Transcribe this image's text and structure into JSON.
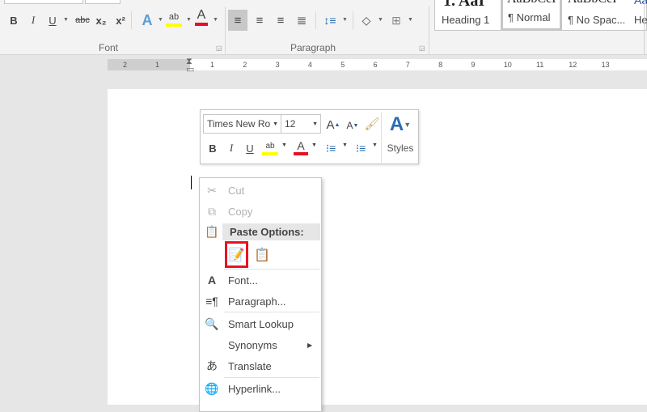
{
  "ribbon": {
    "font_group": {
      "label": "Font",
      "bold": "B",
      "italic": "I",
      "underline": "U",
      "strikethrough": "abc",
      "subscript": "x₂",
      "superscript": "x²",
      "text_effects": "A",
      "highlight": "ab",
      "font_color": "A"
    },
    "paragraph_group": {
      "label": "Paragraph"
    },
    "styles": [
      {
        "preview": "1. AaI",
        "name": "Heading 1"
      },
      {
        "preview": "AaBbCcI",
        "name": "¶ Normal",
        "selected": true
      },
      {
        "preview": "AaBbCcI",
        "name": "¶ No Spac..."
      },
      {
        "preview": "Aa",
        "name": "He"
      }
    ],
    "colors": {
      "highlight": "#ffff00",
      "font_color": "#e81123",
      "accent": "#2b579a"
    }
  },
  "ruler": {
    "left_ticks": [
      "2",
      "1"
    ],
    "right_ticks": [
      "1",
      "2",
      "3",
      "4",
      "5",
      "6",
      "7",
      "8",
      "9",
      "10",
      "11",
      "12",
      "13"
    ]
  },
  "mini_toolbar": {
    "font_name": "Times New Ro",
    "font_size": "12",
    "grow": "A",
    "shrink": "A",
    "bold": "B",
    "italic": "I",
    "underline": "U",
    "highlight": "ab",
    "font_color": "A",
    "styles_label": "Styles"
  },
  "context_menu": {
    "items": [
      {
        "label": "Cut",
        "icon": "scissors-icon",
        "disabled": true
      },
      {
        "label": "Copy",
        "icon": "copy-icon",
        "disabled": true
      },
      {
        "label": "Paste Options:",
        "icon": "paste-icon",
        "header": true
      },
      {
        "label": "Font...",
        "icon": "font-icon"
      },
      {
        "label": "Paragraph...",
        "icon": "paragraph-icon"
      },
      {
        "label": "Smart Lookup",
        "icon": "smart-lookup-icon"
      },
      {
        "label": "Synonyms",
        "icon": "",
        "submenu": true
      },
      {
        "label": "Translate",
        "icon": "translate-icon"
      },
      {
        "label": "Hyperlink...",
        "icon": "hyperlink-icon"
      }
    ],
    "paste_options": [
      "keep-source-formatting",
      "merge-formatting"
    ],
    "selected_paste_option": "keep-source-formatting"
  }
}
